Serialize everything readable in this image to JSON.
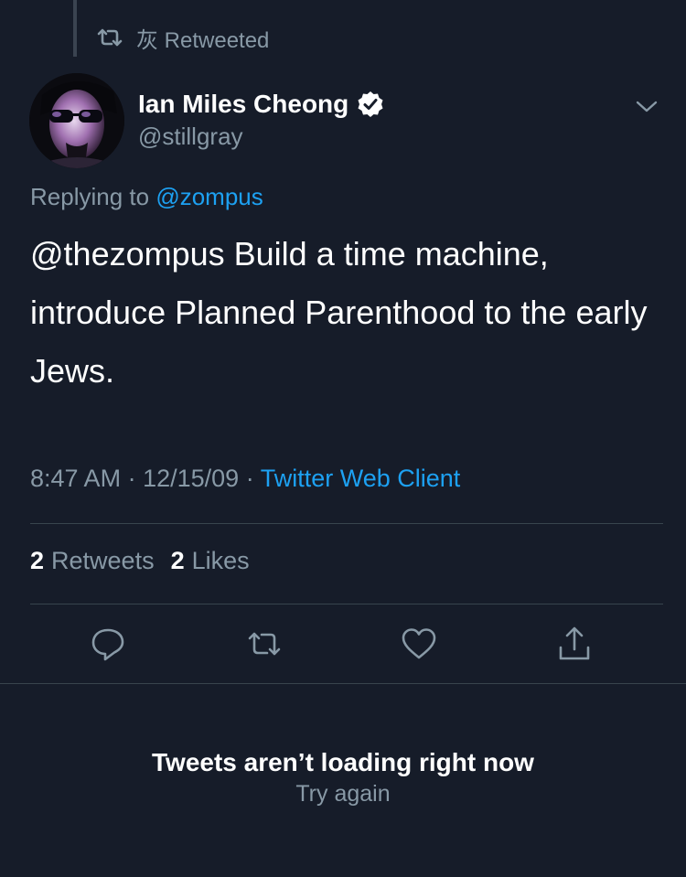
{
  "retweet_banner": {
    "icon": "retweet-icon",
    "text": "灰 Retweeted"
  },
  "tweet": {
    "author": {
      "display_name": "Ian Miles Cheong",
      "handle": "@stillgray",
      "verified": true
    },
    "replying_label": "Replying to",
    "replying_to": "@zompus",
    "text": "@thezompus Build a time machine, introduce Planned Parenthood to the early Jews.",
    "time": "8:47 AM",
    "separator": "·",
    "date": "12/15/09",
    "client": "Twitter Web Client",
    "stats": {
      "retweets_count": "2",
      "retweets_label": "Retweets",
      "likes_count": "2",
      "likes_label": "Likes"
    }
  },
  "actions": [
    "reply-icon",
    "retweet-icon",
    "like-icon",
    "share-icon"
  ],
  "error": {
    "title": "Tweets aren’t loading right now",
    "retry_label": "Try again"
  },
  "colors": {
    "background": "#161c29",
    "text": "#ffffff",
    "secondary": "#8899a6",
    "link": "#1da1f2",
    "divider": "#38444d"
  }
}
